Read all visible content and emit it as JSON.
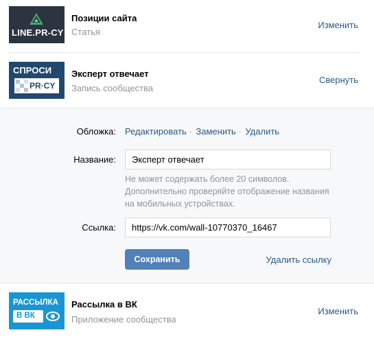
{
  "items": [
    {
      "title": "Позиции сайта",
      "subtitle": "Статья",
      "action": "Изменить",
      "thumb_text": "LINE.PR-CY",
      "thumb_icon": "green-triangle-logo"
    },
    {
      "title": "Эксперт отвечает",
      "subtitle": "Запись сообщества",
      "action": "Свернуть",
      "thumb_text_1": "СПРОСИ",
      "thumb_text_2": "PR·CY"
    },
    {
      "title": "Рассылка в ВК",
      "subtitle": "Приложение сообщества",
      "action": "Изменить",
      "thumb_text_1": "РАССЫЛКА",
      "thumb_text_2": "В ВК"
    }
  ],
  "editor": {
    "cover_label": "Обложка:",
    "cover_edit": "Редактировать",
    "cover_replace": "Заменить",
    "cover_delete": "Удалить",
    "separator": "·",
    "name_label": "Название:",
    "name_value": "Эксперт отвечает",
    "hint": "Не может содержать более 20 символов. Дополнительно проверяйте отображение названия на мобильных устройствах.",
    "link_label": "Ссылка:",
    "link_value": "https://vk.com/wall-10770370_16467",
    "save_button": "Сохранить",
    "delete_link": "Удалить ссылку"
  },
  "colors": {
    "link": "#2a5885",
    "button": "#5181b8",
    "muted": "#939393",
    "panel_bg": "#f7f8fa"
  }
}
